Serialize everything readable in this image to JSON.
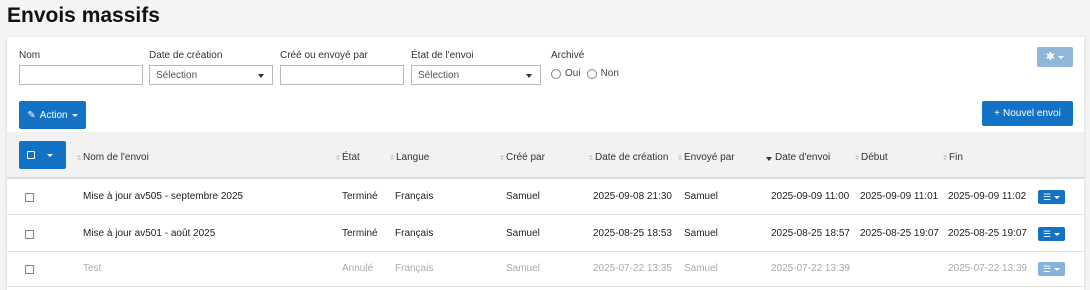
{
  "page": {
    "title": "Envois massifs"
  },
  "filters": {
    "name_label": "Nom",
    "date_label": "Date de création",
    "date_value": "Sélection",
    "by_label": "Créé ou envoyé par",
    "state_label": "État de l'envoi",
    "state_value": "Sélection",
    "archived_label": "Archivé",
    "archived_options": [
      "Oui",
      "Non"
    ]
  },
  "toolbar": {
    "action_label": "Action",
    "new_label": "Nouvel envoi",
    "settings_icon": "gear-icon"
  },
  "table": {
    "columns": [
      "Nom de l'envoi",
      "État",
      "Langue",
      "Créé par",
      "Date de création",
      "Envoyé par",
      "Date d'envoi",
      "Début",
      "Fin"
    ],
    "sorted_column": "Date d'envoi",
    "rows": [
      {
        "name": "Mise à jour av505 - septembre 2025",
        "state": "Terminé",
        "lang": "Français",
        "creator": "Samuel",
        "created": "2025-09-08 21:30",
        "sender": "Samuel",
        "sent": "2025-09-09 11:00",
        "start": "2025-09-09 11:01",
        "end": "2025-09-09 11:02"
      },
      {
        "name": "Mise à jour av501 - août 2025",
        "state": "Terminé",
        "lang": "Français",
        "creator": "Samuel",
        "created": "2025-08-25 18:53",
        "sender": "Samuel",
        "sent": "2025-08-25 18:57",
        "start": "2025-08-25 19:07",
        "end": "2025-08-25 19:07"
      },
      {
        "name": "Test",
        "state": "Annulé",
        "lang": "Français",
        "creator": "Samuel",
        "created": "2025-07-22 13:35",
        "sender": "Samuel",
        "sent": "2025-07-22 13:39",
        "start": "",
        "end": "2025-07-22 13:39"
      }
    ]
  }
}
